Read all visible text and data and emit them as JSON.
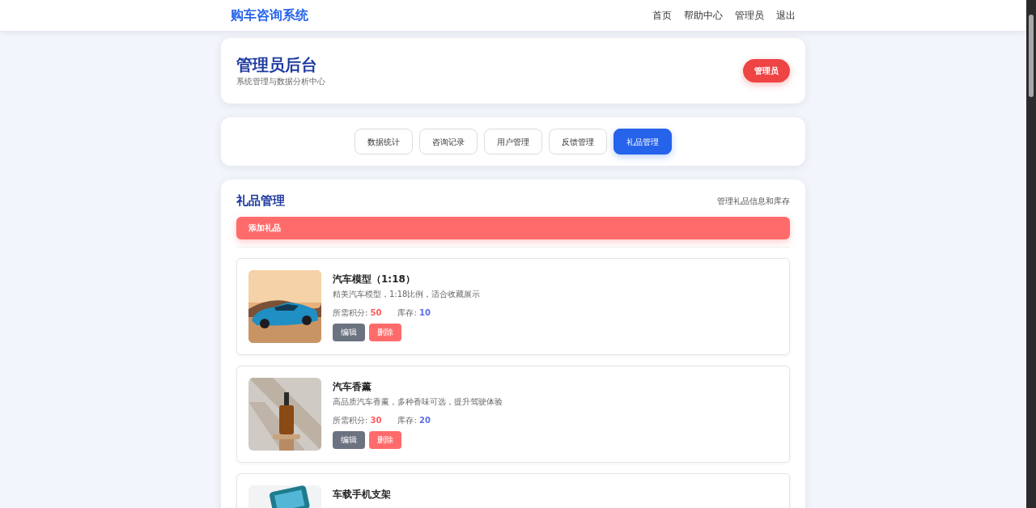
{
  "nav": {
    "brand": "购车咨询系统",
    "links": [
      "首页",
      "帮助中心",
      "管理员",
      "退出"
    ]
  },
  "header": {
    "title": "管理员后台",
    "subtitle": "系统管理与数据分析中心",
    "role_badge": "管理员"
  },
  "tabs": [
    {
      "label": "数据统计",
      "selected": false
    },
    {
      "label": "咨询记录",
      "selected": false
    },
    {
      "label": "用户管理",
      "selected": false
    },
    {
      "label": "反馈管理",
      "selected": false
    },
    {
      "label": "礼品管理",
      "selected": true
    }
  ],
  "gifts_panel": {
    "title": "礼品管理",
    "hint": "管理礼品信息和库存",
    "add_button": "添加礼品",
    "items": [
      {
        "name": "汽车模型（1:18）",
        "description": "精美汽车模型，1:18比例，适合收藏展示",
        "points_label": "所需积分:",
        "points": "50",
        "stock_label": "库存:",
        "stock": "10",
        "edit": "编辑",
        "delete": "删除"
      },
      {
        "name": "汽车香薰",
        "description": "高品质汽车香薰，多种香味可选，提升驾驶体验",
        "points_label": "所需积分:",
        "points": "30",
        "stock_label": "库存:",
        "stock": "20",
        "edit": "编辑",
        "delete": "删除"
      },
      {
        "name": "车载手机支架"
      }
    ]
  }
}
